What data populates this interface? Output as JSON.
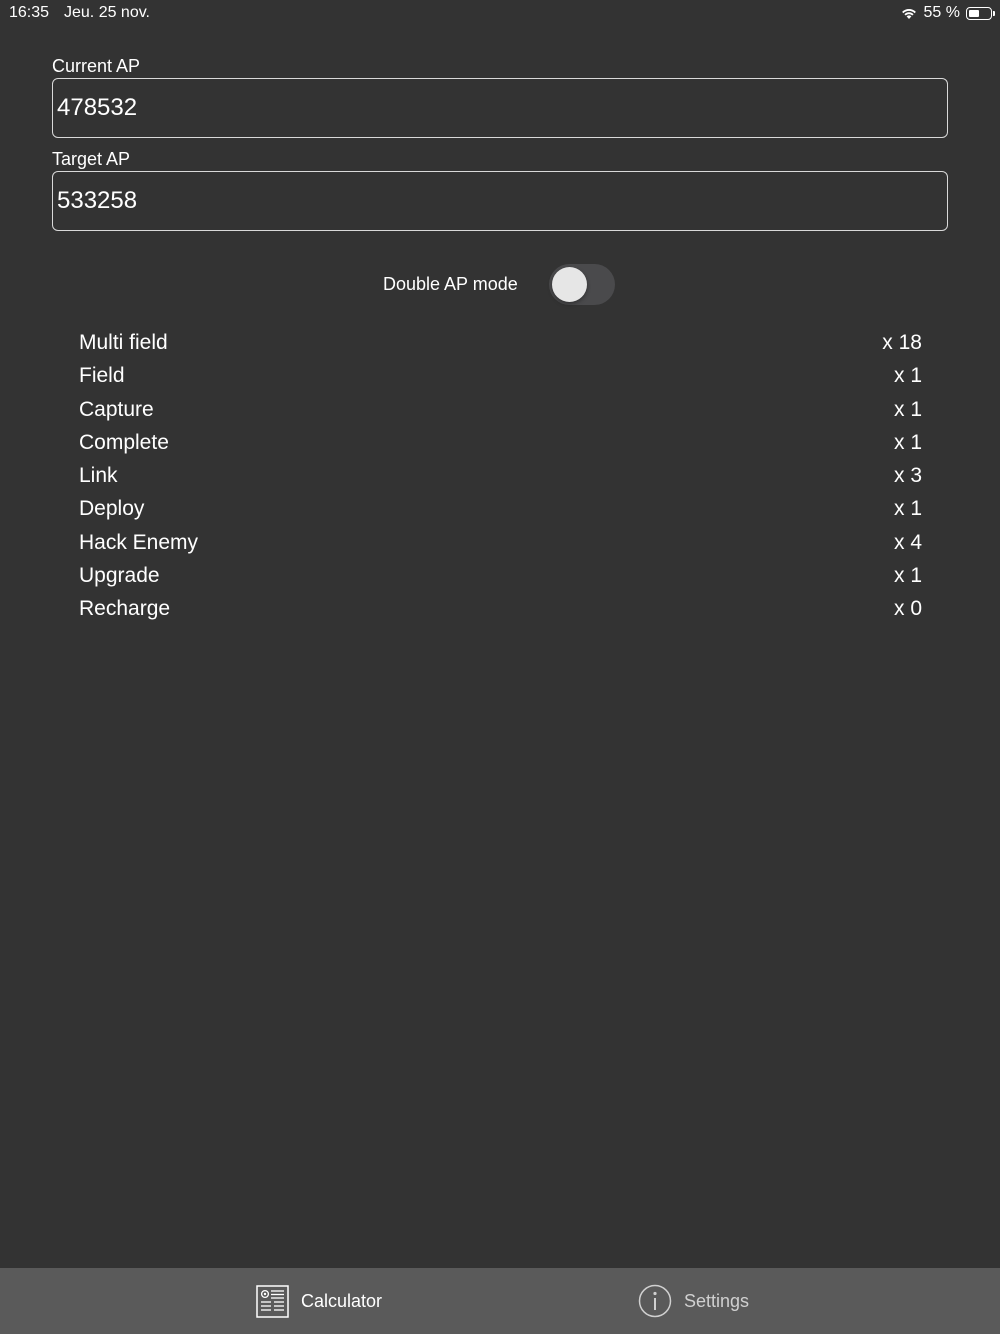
{
  "status_bar": {
    "time": "16:35",
    "date": "Jeu. 25 nov.",
    "battery_text": "55 %",
    "battery_level": 0.55,
    "wifi_icon": "wifi-icon",
    "battery_icon": "battery-icon"
  },
  "form": {
    "current_ap": {
      "label": "Current AP",
      "value": "478532"
    },
    "target_ap": {
      "label": "Target AP",
      "value": "533258"
    }
  },
  "double_ap": {
    "label": "Double AP mode",
    "enabled": false
  },
  "results": [
    {
      "name": "Multi field",
      "count": "x 18"
    },
    {
      "name": "Field",
      "count": "x 1"
    },
    {
      "name": "Capture",
      "count": "x 1"
    },
    {
      "name": "Complete",
      "count": "x 1"
    },
    {
      "name": "Link",
      "count": "x 3"
    },
    {
      "name": "Deploy",
      "count": "x 1"
    },
    {
      "name": "Hack Enemy",
      "count": "x 4"
    },
    {
      "name": "Upgrade",
      "count": "x 1"
    },
    {
      "name": "Recharge",
      "count": "x 0"
    }
  ],
  "tab_bar": {
    "tabs": [
      {
        "label": "Calculator",
        "icon": "calculator-icon",
        "selected": true
      },
      {
        "label": "Settings",
        "icon": "info-icon",
        "selected": false
      }
    ]
  },
  "colors": {
    "background": "#333333",
    "tab_bar": "#5a5a5a",
    "field_border": "#d9d9d9",
    "toggle_track_off": "#4a4a4c"
  }
}
